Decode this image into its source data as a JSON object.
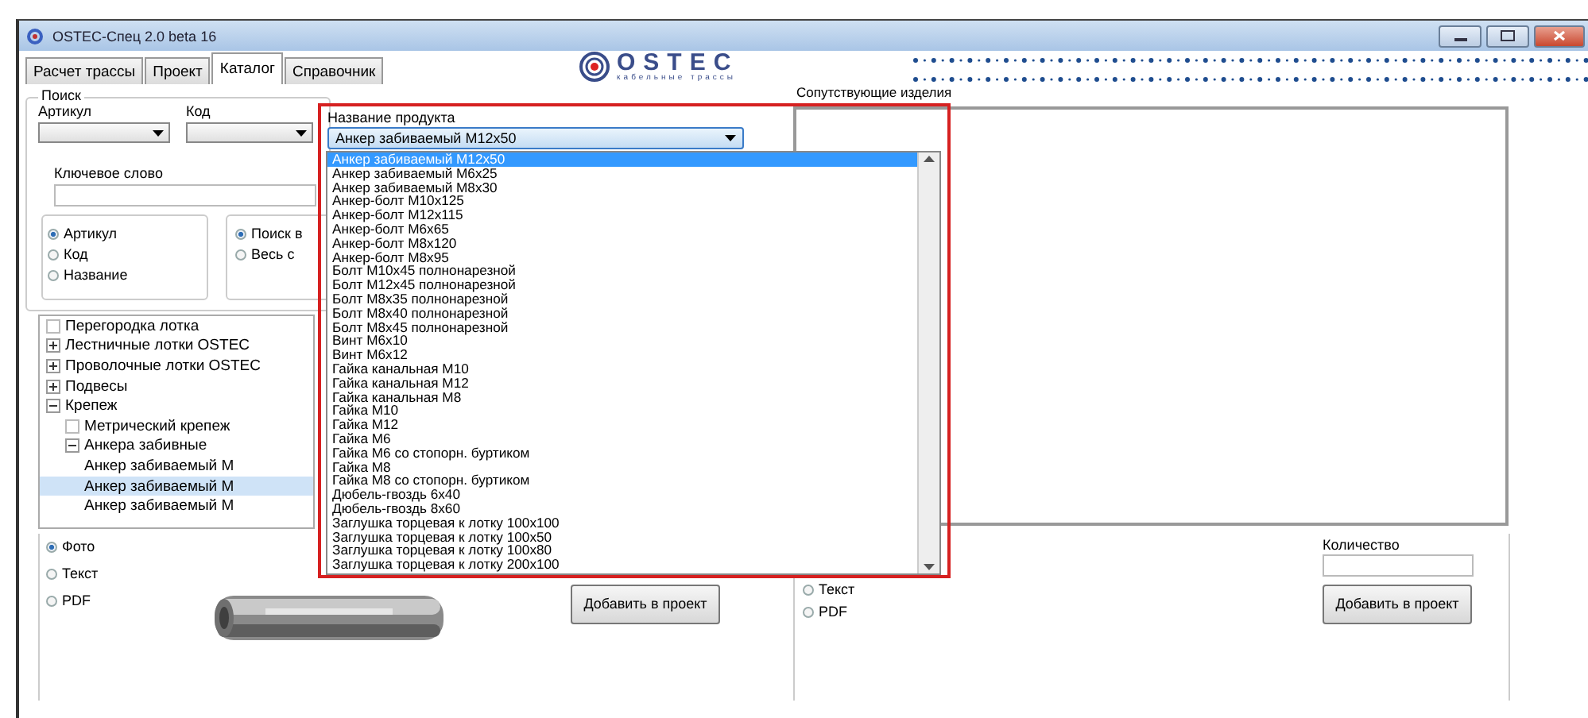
{
  "window": {
    "title": "OSTEC-Спец 2.0 beta 16"
  },
  "tabs": [
    {
      "label": "Расчет трассы",
      "selected": false
    },
    {
      "label": "Проект",
      "selected": false
    },
    {
      "label": "Каталог",
      "selected": true
    },
    {
      "label": "Справочник",
      "selected": false
    }
  ],
  "logo": {
    "name": "OSTEC",
    "tagline": "кабельные трассы"
  },
  "search": {
    "title": "Поиск",
    "article_label": "Артикул",
    "code_label": "Код",
    "keyword_label": "Ключевое слово",
    "field_options": [
      {
        "label": "Артикул",
        "selected": true
      },
      {
        "label": "Код",
        "selected": false
      },
      {
        "label": "Название",
        "selected": false
      }
    ],
    "scope_options": [
      {
        "label": "Поиск в",
        "selected": true
      },
      {
        "label": "Весь с",
        "selected": false
      }
    ]
  },
  "tree": [
    {
      "label": "Перегородка лотка"
    },
    {
      "label": "Лестничные лотки OSTEC",
      "expanded": false
    },
    {
      "label": "Проволочные лотки OSTEC",
      "expanded": false
    },
    {
      "label": "Подвесы",
      "expanded": false
    },
    {
      "label": "Крепеж",
      "expanded": true,
      "children": [
        {
          "label": "Метрический крепеж"
        },
        {
          "label": "Анкера забивные",
          "expanded": true,
          "children": [
            {
              "label": "Анкер забиваемый M",
              "selected": false
            },
            {
              "label": "Анкер забиваемый M",
              "selected": true
            },
            {
              "label": "Анкер забиваемый M",
              "selected": false
            }
          ]
        }
      ]
    }
  ],
  "product": {
    "label": "Название продукта",
    "value": "Анкер забиваемый M12x50",
    "options": [
      {
        "label": "Анкер забиваемый M12x50",
        "selected": true
      },
      {
        "label": "Анкер забиваемый M6x25",
        "selected": false
      },
      {
        "label": "Анкер забиваемый M8x30",
        "selected": false
      },
      {
        "label": "Анкер-болт M10x125",
        "selected": false
      },
      {
        "label": "Анкер-болт M12x115",
        "selected": false
      },
      {
        "label": "Анкер-болт M6x65",
        "selected": false
      },
      {
        "label": "Анкер-болт M8x120",
        "selected": false
      },
      {
        "label": "Анкер-болт M8x95",
        "selected": false
      },
      {
        "label": "Болт M10x45 полнонарезной",
        "selected": false
      },
      {
        "label": "Болт M12x45 полнонарезной",
        "selected": false
      },
      {
        "label": "Болт M8x35 полнонарезной",
        "selected": false
      },
      {
        "label": "Болт M8x40 полнонарезной",
        "selected": false
      },
      {
        "label": "Болт M8x45 полнонарезной",
        "selected": false
      },
      {
        "label": "Винт M6x10",
        "selected": false
      },
      {
        "label": "Винт M6x12",
        "selected": false
      },
      {
        "label": "Гайка канальная M10",
        "selected": false
      },
      {
        "label": "Гайка канальная M12",
        "selected": false
      },
      {
        "label": "Гайка канальная M8",
        "selected": false
      },
      {
        "label": "Гайка M10",
        "selected": false
      },
      {
        "label": "Гайка M12",
        "selected": false
      },
      {
        "label": "Гайка M6",
        "selected": false
      },
      {
        "label": "Гайка M6 со стопорн. буртиком",
        "selected": false
      },
      {
        "label": "Гайка M8",
        "selected": false
      },
      {
        "label": "Гайка M8 со стопорн. буртиком",
        "selected": false
      },
      {
        "label": "Дюбель-гвоздь 6x40",
        "selected": false
      },
      {
        "label": "Дюбель-гвоздь 8x60",
        "selected": false
      },
      {
        "label": "Заглушка торцевая к лотку 100x100",
        "selected": false
      },
      {
        "label": "Заглушка торцевая к лотку 100x50",
        "selected": false
      },
      {
        "label": "Заглушка торцевая к лотку 100x80",
        "selected": false
      },
      {
        "label": "Заглушка торцевая к лотку 200x100",
        "selected": false
      }
    ]
  },
  "related": {
    "label": "Сопутствующие изделия"
  },
  "left_view": {
    "options": [
      {
        "label": "Фото",
        "selected": true
      },
      {
        "label": "Текст",
        "selected": false
      },
      {
        "label": "PDF",
        "selected": false
      }
    ],
    "button": "Добавить в проект"
  },
  "right_view": {
    "options": [
      {
        "label": "Текст",
        "selected": false
      },
      {
        "label": "PDF",
        "selected": false
      }
    ],
    "quantity_label": "Количество",
    "button": "Добавить в проект"
  }
}
